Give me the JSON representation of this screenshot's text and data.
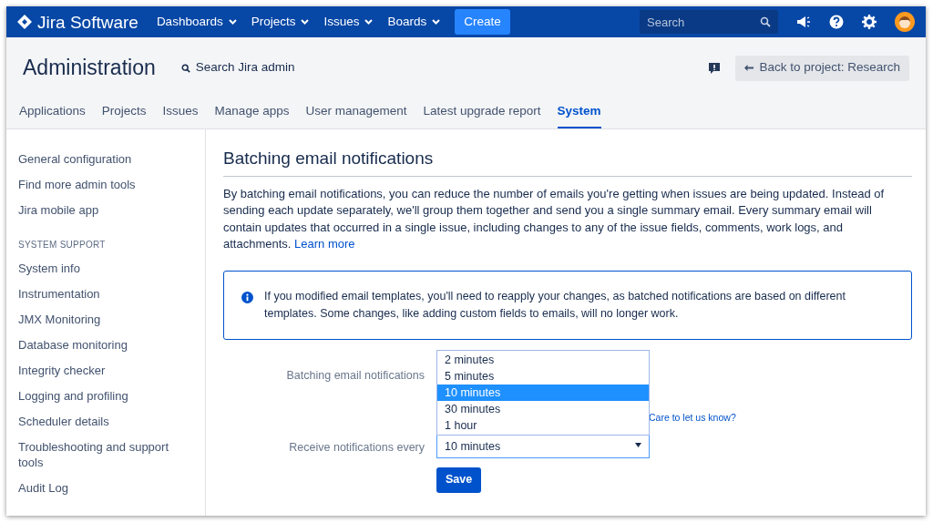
{
  "header": {
    "logo": "Jira Software",
    "nav": [
      {
        "label": "Dashboards"
      },
      {
        "label": "Projects"
      },
      {
        "label": "Issues"
      },
      {
        "label": "Boards"
      }
    ],
    "create": "Create",
    "search": {
      "placeholder": "Search"
    }
  },
  "admin": {
    "title": "Administration",
    "search": "Search Jira admin",
    "back_button": "Back to project: Research",
    "tabs": [
      {
        "label": "Applications",
        "selected": false
      },
      {
        "label": "Projects",
        "selected": false
      },
      {
        "label": "Issues",
        "selected": false
      },
      {
        "label": "Manage apps",
        "selected": false
      },
      {
        "label": "User management",
        "selected": false
      },
      {
        "label": "Latest upgrade report",
        "selected": false
      },
      {
        "label": "System",
        "selected": true
      }
    ]
  },
  "sidebar": {
    "items": [
      "General configuration",
      "Find more admin tools",
      "Jira mobile app"
    ],
    "section": "SYSTEM SUPPORT",
    "support_items": [
      "System info",
      "Instrumentation",
      "JMX Monitoring",
      "Database monitoring",
      "Integrity checker",
      "Logging and profiling",
      "Scheduler details",
      "Troubleshooting and support tools",
      "Audit Log"
    ]
  },
  "main": {
    "heading": "Batching email notifications",
    "description": "By batching email notifications, you can reduce the number of emails you're getting when issues are being updated. Instead of sending each update separately, we'll group them together and send you a single summary email. Every summary email will contain updates that occurred in a single issue, including changes to any of the issue fields, comments, work logs, and attachments.",
    "learn_more": "Learn more",
    "info": "If you modified email templates, you'll need to reapply your changes, as batched notifications are based on different templates. Some changes, like adding custom fields to emails, will no longer work.",
    "batching_label": "Batching email notifications",
    "feedback_link": "Care to let us know?",
    "interval": {
      "label": "Receive notifications every",
      "value": "10 minutes",
      "expanded": true,
      "options": [
        {
          "label": "2 minutes",
          "selected": false
        },
        {
          "label": "5 minutes",
          "selected": false
        },
        {
          "label": "10 minutes",
          "selected": true
        },
        {
          "label": "30 minutes",
          "selected": false
        },
        {
          "label": "1 hour",
          "selected": false
        }
      ]
    },
    "save": "Save"
  }
}
